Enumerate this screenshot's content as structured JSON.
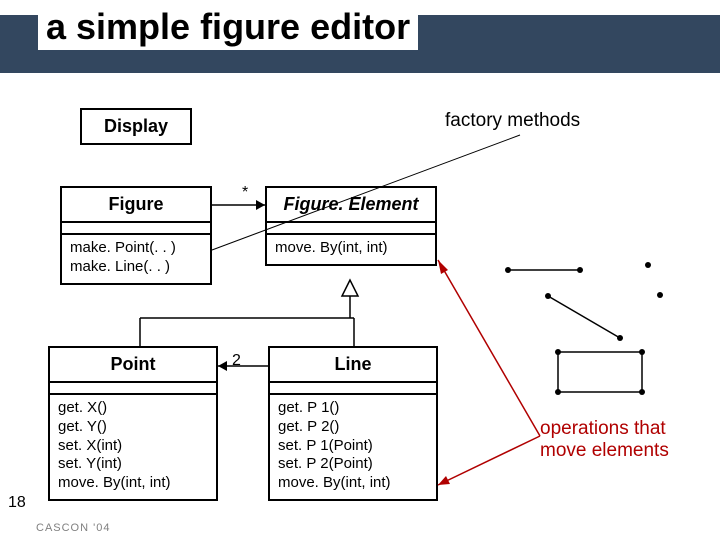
{
  "title": "a simple figure editor",
  "page_number": "18",
  "footer": "CASCON '04",
  "notes": {
    "factory": "factory methods",
    "move_ops": "operations that\nmove elements"
  },
  "mult": {
    "star": "*",
    "two": "2"
  },
  "classes": {
    "display": {
      "name": "Display"
    },
    "figure": {
      "name": "Figure",
      "methods": [
        "make. Point(. . )",
        "make. Line(. . )"
      ]
    },
    "figure_element": {
      "name": "Figure. Element",
      "methods": [
        "move. By(int, int)"
      ]
    },
    "point": {
      "name": "Point",
      "methods": [
        "get. X()",
        "get. Y()",
        "set. X(int)",
        "set. Y(int)",
        "move. By(int, int)"
      ]
    },
    "line": {
      "name": "Line",
      "methods": [
        "get. P 1()",
        "get. P 2()",
        "set. P 1(Point)",
        "set. P 2(Point)",
        "move. By(int, int)"
      ]
    }
  }
}
